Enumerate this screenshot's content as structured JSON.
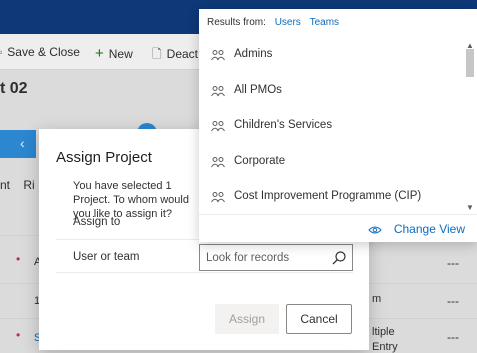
{
  "commandbar": {
    "save_close": "Save & Close",
    "new": "New",
    "deactivate_partial": "Deact"
  },
  "record": {
    "title_partial": "t 02"
  },
  "background": {
    "tabs_partial": "nt    Ri",
    "row_texts": [
      "A",
      "1",
      "S",
      "m",
      "ltiple",
      "Entry"
    ],
    "empty_value": "---"
  },
  "dialog": {
    "title": "Assign Project",
    "message": "You have selected 1 Project. To whom would you like to assign it?",
    "assign_to_label": "Assign to",
    "user_or_team_label": "User or team",
    "assign_button": "Assign",
    "cancel_button": "Cancel"
  },
  "lookup": {
    "placeholder": "Look for records"
  },
  "results": {
    "header_label": "Results from:",
    "filters": [
      "Users",
      "Teams"
    ],
    "items": [
      "Admins",
      "All PMOs",
      "Children's Services",
      "Corporate",
      "Cost Improvement Programme (CIP)"
    ],
    "change_view": "Change View"
  },
  "colors": {
    "top_bar": "#0f3c80",
    "link_blue": "#0f6cbd",
    "process_blue": "#2f8fdd"
  }
}
